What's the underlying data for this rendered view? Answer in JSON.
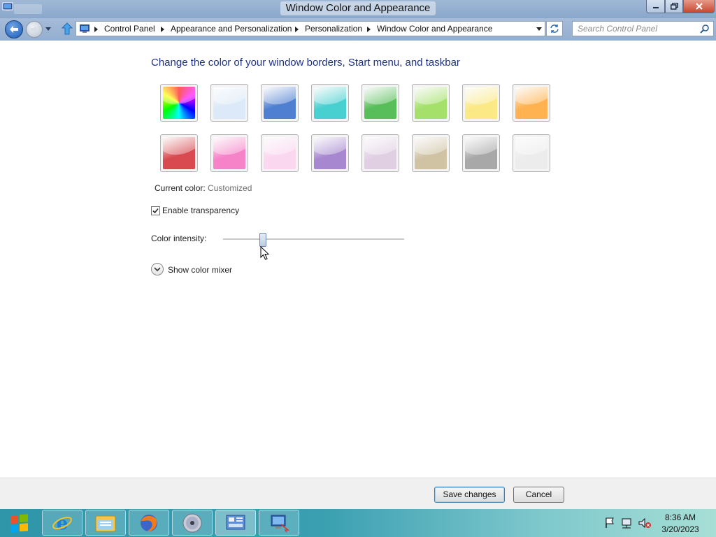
{
  "window": {
    "title": "Window Color and Appearance"
  },
  "breadcrumb": [
    "Control Panel",
    "Appearance and Personalization",
    "Personalization",
    "Window Color and Appearance"
  ],
  "search": {
    "placeholder": "Search Control Panel"
  },
  "content": {
    "heading": "Change the color of your window borders, Start menu, and taskbar",
    "swatches": [
      {
        "name": "rainbow",
        "color": "conic"
      },
      {
        "name": "sky",
        "color": "#dbe9f8"
      },
      {
        "name": "twilight",
        "color": "#4f7fd0"
      },
      {
        "name": "sea",
        "color": "#48cfd0"
      },
      {
        "name": "leaf",
        "color": "#58be5a"
      },
      {
        "name": "lime",
        "color": "#a4e06a"
      },
      {
        "name": "lemon",
        "color": "#fbe985"
      },
      {
        "name": "pumpkin",
        "color": "#ffb24f"
      },
      {
        "name": "ruby",
        "color": "#d84a50"
      },
      {
        "name": "fuchsia",
        "color": "#f682c8"
      },
      {
        "name": "blush",
        "color": "#fbd6ef"
      },
      {
        "name": "violet",
        "color": "#a687d0"
      },
      {
        "name": "lavender",
        "color": "#e0cfe3"
      },
      {
        "name": "taupe",
        "color": "#cfc3a4"
      },
      {
        "name": "chocolate",
        "color": "#a8a8a8"
      },
      {
        "name": "frost",
        "color": "#ececec"
      }
    ],
    "current_color_label": "Current color:",
    "current_color_value": "Customized",
    "transparency_label": "Enable transparency",
    "transparency_checked": true,
    "intensity_label": "Color intensity:",
    "intensity_fraction": 0.22,
    "mixer_label": "Show color mixer"
  },
  "footer": {
    "save_label": "Save changes",
    "cancel_label": "Cancel"
  },
  "taskbar": {
    "time": "8:36 AM",
    "date": "3/20/2023",
    "pinned": [
      "internet-explorer",
      "file-explorer",
      "firefox",
      "media-disc",
      "control-panel",
      "remote-desktop"
    ]
  }
}
